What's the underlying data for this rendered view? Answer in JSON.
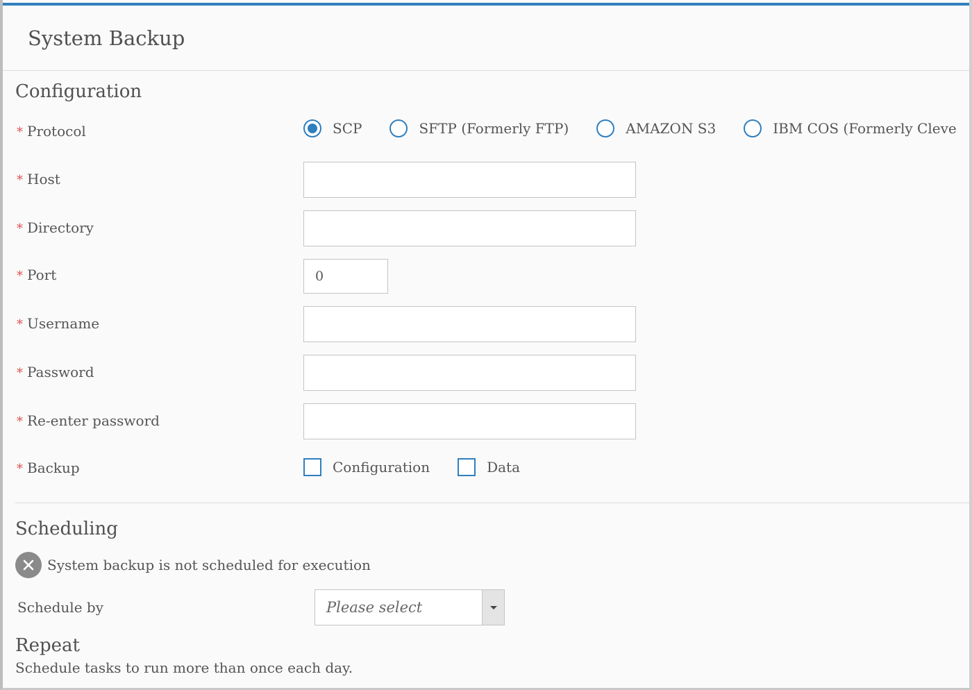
{
  "page": {
    "title": "System Backup"
  },
  "configuration": {
    "title": "Configuration",
    "required_mark": "*",
    "protocol": {
      "label": "Protocol",
      "options": [
        {
          "label": "SCP",
          "selected": true
        },
        {
          "label": "SFTP (Formerly FTP)",
          "selected": false
        },
        {
          "label": "AMAZON S3",
          "selected": false
        },
        {
          "label": "IBM COS (Formerly Cleve",
          "selected": false
        }
      ]
    },
    "host": {
      "label": "Host",
      "value": ""
    },
    "directory": {
      "label": "Directory",
      "value": ""
    },
    "port": {
      "label": "Port",
      "value": "0"
    },
    "username": {
      "label": "Username",
      "value": ""
    },
    "password": {
      "label": "Password",
      "value": ""
    },
    "reenter_password": {
      "label": "Re-enter password",
      "value": ""
    },
    "backup": {
      "label": "Backup",
      "options": [
        {
          "label": "Configuration",
          "checked": false
        },
        {
          "label": "Data",
          "checked": false
        }
      ]
    }
  },
  "scheduling": {
    "title": "Scheduling",
    "status_text": "System backup is not scheduled for execution",
    "schedule_by": {
      "label": "Schedule by",
      "selected": "Please select"
    }
  },
  "repeat": {
    "title": "Repeat",
    "description": "Schedule tasks to run more than once each day."
  },
  "colors": {
    "accent": "#2f7fbf",
    "required": "#d9534f",
    "status_icon": "#8a8a8a"
  }
}
